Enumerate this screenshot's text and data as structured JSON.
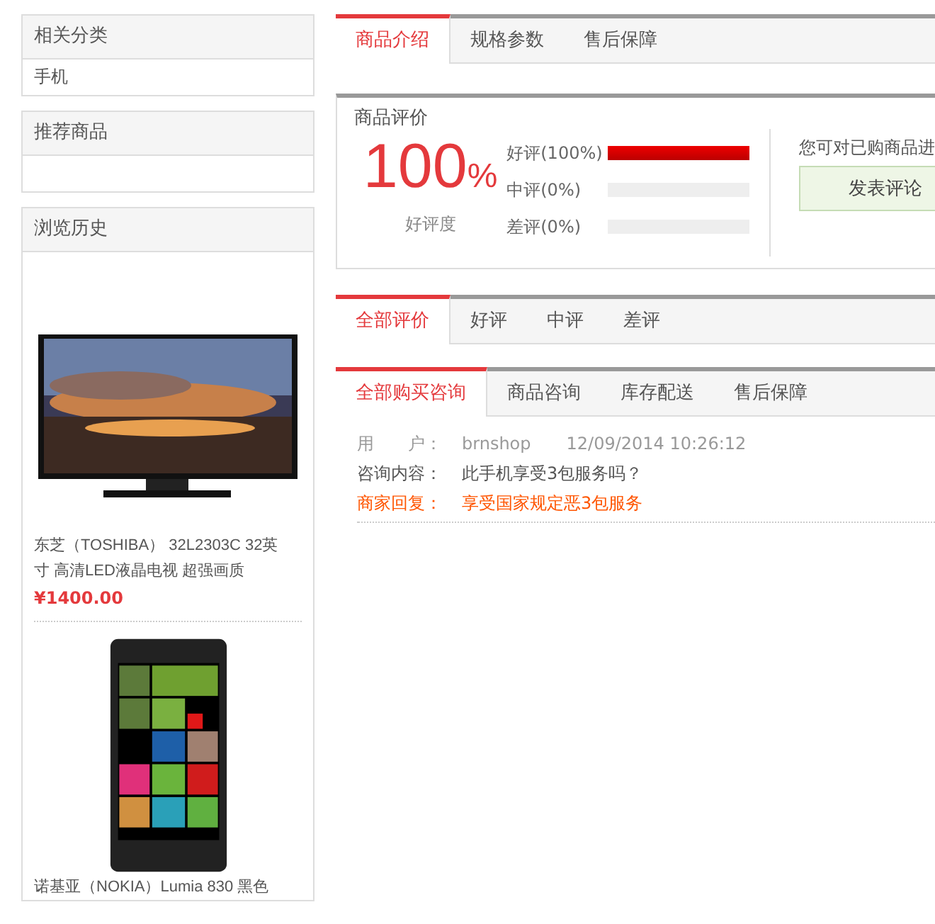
{
  "sidebar": {
    "boxes": [
      {
        "title": "相关分类",
        "items": [
          "手机"
        ]
      },
      {
        "title": "推荐商品"
      },
      {
        "title": "浏览历史",
        "products": [
          {
            "kind": "tv",
            "name": "东芝（TOSHIBA） 32L2303C 32英寸 高清LED液晶电视 超强画质",
            "price": "¥1400.00"
          },
          {
            "kind": "phone",
            "name": "诺基亚（NOKIA）Lumia 830 黑色"
          }
        ]
      }
    ]
  },
  "product_tabs": [
    {
      "label": "商品介绍",
      "selected": true
    },
    {
      "label": "规格参数",
      "selected": false
    },
    {
      "label": "售后保障",
      "selected": false
    }
  ],
  "rating": {
    "title": "商品评价",
    "score": "100",
    "unit": "%",
    "score_label": "好评度",
    "bars": [
      {
        "label": "好评(100%)",
        "level": 1
      },
      {
        "label": "中评(0%)",
        "level": 0
      },
      {
        "label": "差评(0%)",
        "level": 0
      }
    ],
    "prompt": "您可对已购商品进",
    "button": "发表评论"
  },
  "review_tabs": [
    {
      "label": "全部评价",
      "selected": true
    },
    {
      "label": "好评",
      "selected": false
    },
    {
      "label": "中评",
      "selected": false
    },
    {
      "label": "差评",
      "selected": false
    }
  ],
  "consult_tabs": [
    {
      "label": "全部购买咨询",
      "selected": true
    },
    {
      "label": "商品咨询",
      "selected": false
    },
    {
      "label": "库存配送",
      "selected": false
    },
    {
      "label": "售后保障",
      "selected": false
    }
  ],
  "consults": [
    {
      "user_label": "用　　户：",
      "user": "brnshop",
      "time": "12/09/2014 10:26:12",
      "question_label": "咨询内容：",
      "question": "此手机享受3包服务吗？",
      "reply_label": "商家回复：",
      "reply": "享受国家规定恶3包服务"
    }
  ]
}
